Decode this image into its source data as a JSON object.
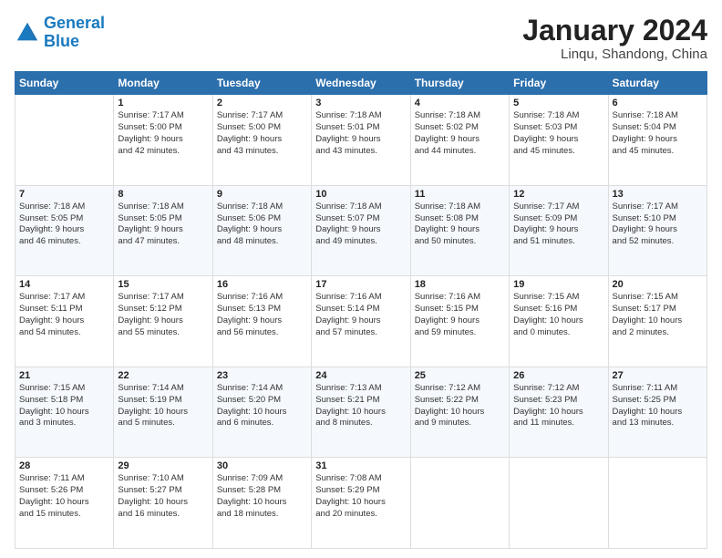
{
  "logo": {
    "line1": "General",
    "line2": "Blue"
  },
  "title": "January 2024",
  "subtitle": "Linqu, Shandong, China",
  "days_of_week": [
    "Sunday",
    "Monday",
    "Tuesday",
    "Wednesday",
    "Thursday",
    "Friday",
    "Saturday"
  ],
  "weeks": [
    [
      {
        "day": "",
        "info": ""
      },
      {
        "day": "1",
        "info": "Sunrise: 7:17 AM\nSunset: 5:00 PM\nDaylight: 9 hours\nand 42 minutes."
      },
      {
        "day": "2",
        "info": "Sunrise: 7:17 AM\nSunset: 5:00 PM\nDaylight: 9 hours\nand 43 minutes."
      },
      {
        "day": "3",
        "info": "Sunrise: 7:18 AM\nSunset: 5:01 PM\nDaylight: 9 hours\nand 43 minutes."
      },
      {
        "day": "4",
        "info": "Sunrise: 7:18 AM\nSunset: 5:02 PM\nDaylight: 9 hours\nand 44 minutes."
      },
      {
        "day": "5",
        "info": "Sunrise: 7:18 AM\nSunset: 5:03 PM\nDaylight: 9 hours\nand 45 minutes."
      },
      {
        "day": "6",
        "info": "Sunrise: 7:18 AM\nSunset: 5:04 PM\nDaylight: 9 hours\nand 45 minutes."
      }
    ],
    [
      {
        "day": "7",
        "info": "Sunrise: 7:18 AM\nSunset: 5:05 PM\nDaylight: 9 hours\nand 46 minutes."
      },
      {
        "day": "8",
        "info": "Sunrise: 7:18 AM\nSunset: 5:05 PM\nDaylight: 9 hours\nand 47 minutes."
      },
      {
        "day": "9",
        "info": "Sunrise: 7:18 AM\nSunset: 5:06 PM\nDaylight: 9 hours\nand 48 minutes."
      },
      {
        "day": "10",
        "info": "Sunrise: 7:18 AM\nSunset: 5:07 PM\nDaylight: 9 hours\nand 49 minutes."
      },
      {
        "day": "11",
        "info": "Sunrise: 7:18 AM\nSunset: 5:08 PM\nDaylight: 9 hours\nand 50 minutes."
      },
      {
        "day": "12",
        "info": "Sunrise: 7:17 AM\nSunset: 5:09 PM\nDaylight: 9 hours\nand 51 minutes."
      },
      {
        "day": "13",
        "info": "Sunrise: 7:17 AM\nSunset: 5:10 PM\nDaylight: 9 hours\nand 52 minutes."
      }
    ],
    [
      {
        "day": "14",
        "info": "Sunrise: 7:17 AM\nSunset: 5:11 PM\nDaylight: 9 hours\nand 54 minutes."
      },
      {
        "day": "15",
        "info": "Sunrise: 7:17 AM\nSunset: 5:12 PM\nDaylight: 9 hours\nand 55 minutes."
      },
      {
        "day": "16",
        "info": "Sunrise: 7:16 AM\nSunset: 5:13 PM\nDaylight: 9 hours\nand 56 minutes."
      },
      {
        "day": "17",
        "info": "Sunrise: 7:16 AM\nSunset: 5:14 PM\nDaylight: 9 hours\nand 57 minutes."
      },
      {
        "day": "18",
        "info": "Sunrise: 7:16 AM\nSunset: 5:15 PM\nDaylight: 9 hours\nand 59 minutes."
      },
      {
        "day": "19",
        "info": "Sunrise: 7:15 AM\nSunset: 5:16 PM\nDaylight: 10 hours\nand 0 minutes."
      },
      {
        "day": "20",
        "info": "Sunrise: 7:15 AM\nSunset: 5:17 PM\nDaylight: 10 hours\nand 2 minutes."
      }
    ],
    [
      {
        "day": "21",
        "info": "Sunrise: 7:15 AM\nSunset: 5:18 PM\nDaylight: 10 hours\nand 3 minutes."
      },
      {
        "day": "22",
        "info": "Sunrise: 7:14 AM\nSunset: 5:19 PM\nDaylight: 10 hours\nand 5 minutes."
      },
      {
        "day": "23",
        "info": "Sunrise: 7:14 AM\nSunset: 5:20 PM\nDaylight: 10 hours\nand 6 minutes."
      },
      {
        "day": "24",
        "info": "Sunrise: 7:13 AM\nSunset: 5:21 PM\nDaylight: 10 hours\nand 8 minutes."
      },
      {
        "day": "25",
        "info": "Sunrise: 7:12 AM\nSunset: 5:22 PM\nDaylight: 10 hours\nand 9 minutes."
      },
      {
        "day": "26",
        "info": "Sunrise: 7:12 AM\nSunset: 5:23 PM\nDaylight: 10 hours\nand 11 minutes."
      },
      {
        "day": "27",
        "info": "Sunrise: 7:11 AM\nSunset: 5:25 PM\nDaylight: 10 hours\nand 13 minutes."
      }
    ],
    [
      {
        "day": "28",
        "info": "Sunrise: 7:11 AM\nSunset: 5:26 PM\nDaylight: 10 hours\nand 15 minutes."
      },
      {
        "day": "29",
        "info": "Sunrise: 7:10 AM\nSunset: 5:27 PM\nDaylight: 10 hours\nand 16 minutes."
      },
      {
        "day": "30",
        "info": "Sunrise: 7:09 AM\nSunset: 5:28 PM\nDaylight: 10 hours\nand 18 minutes."
      },
      {
        "day": "31",
        "info": "Sunrise: 7:08 AM\nSunset: 5:29 PM\nDaylight: 10 hours\nand 20 minutes."
      },
      {
        "day": "",
        "info": ""
      },
      {
        "day": "",
        "info": ""
      },
      {
        "day": "",
        "info": ""
      }
    ]
  ]
}
